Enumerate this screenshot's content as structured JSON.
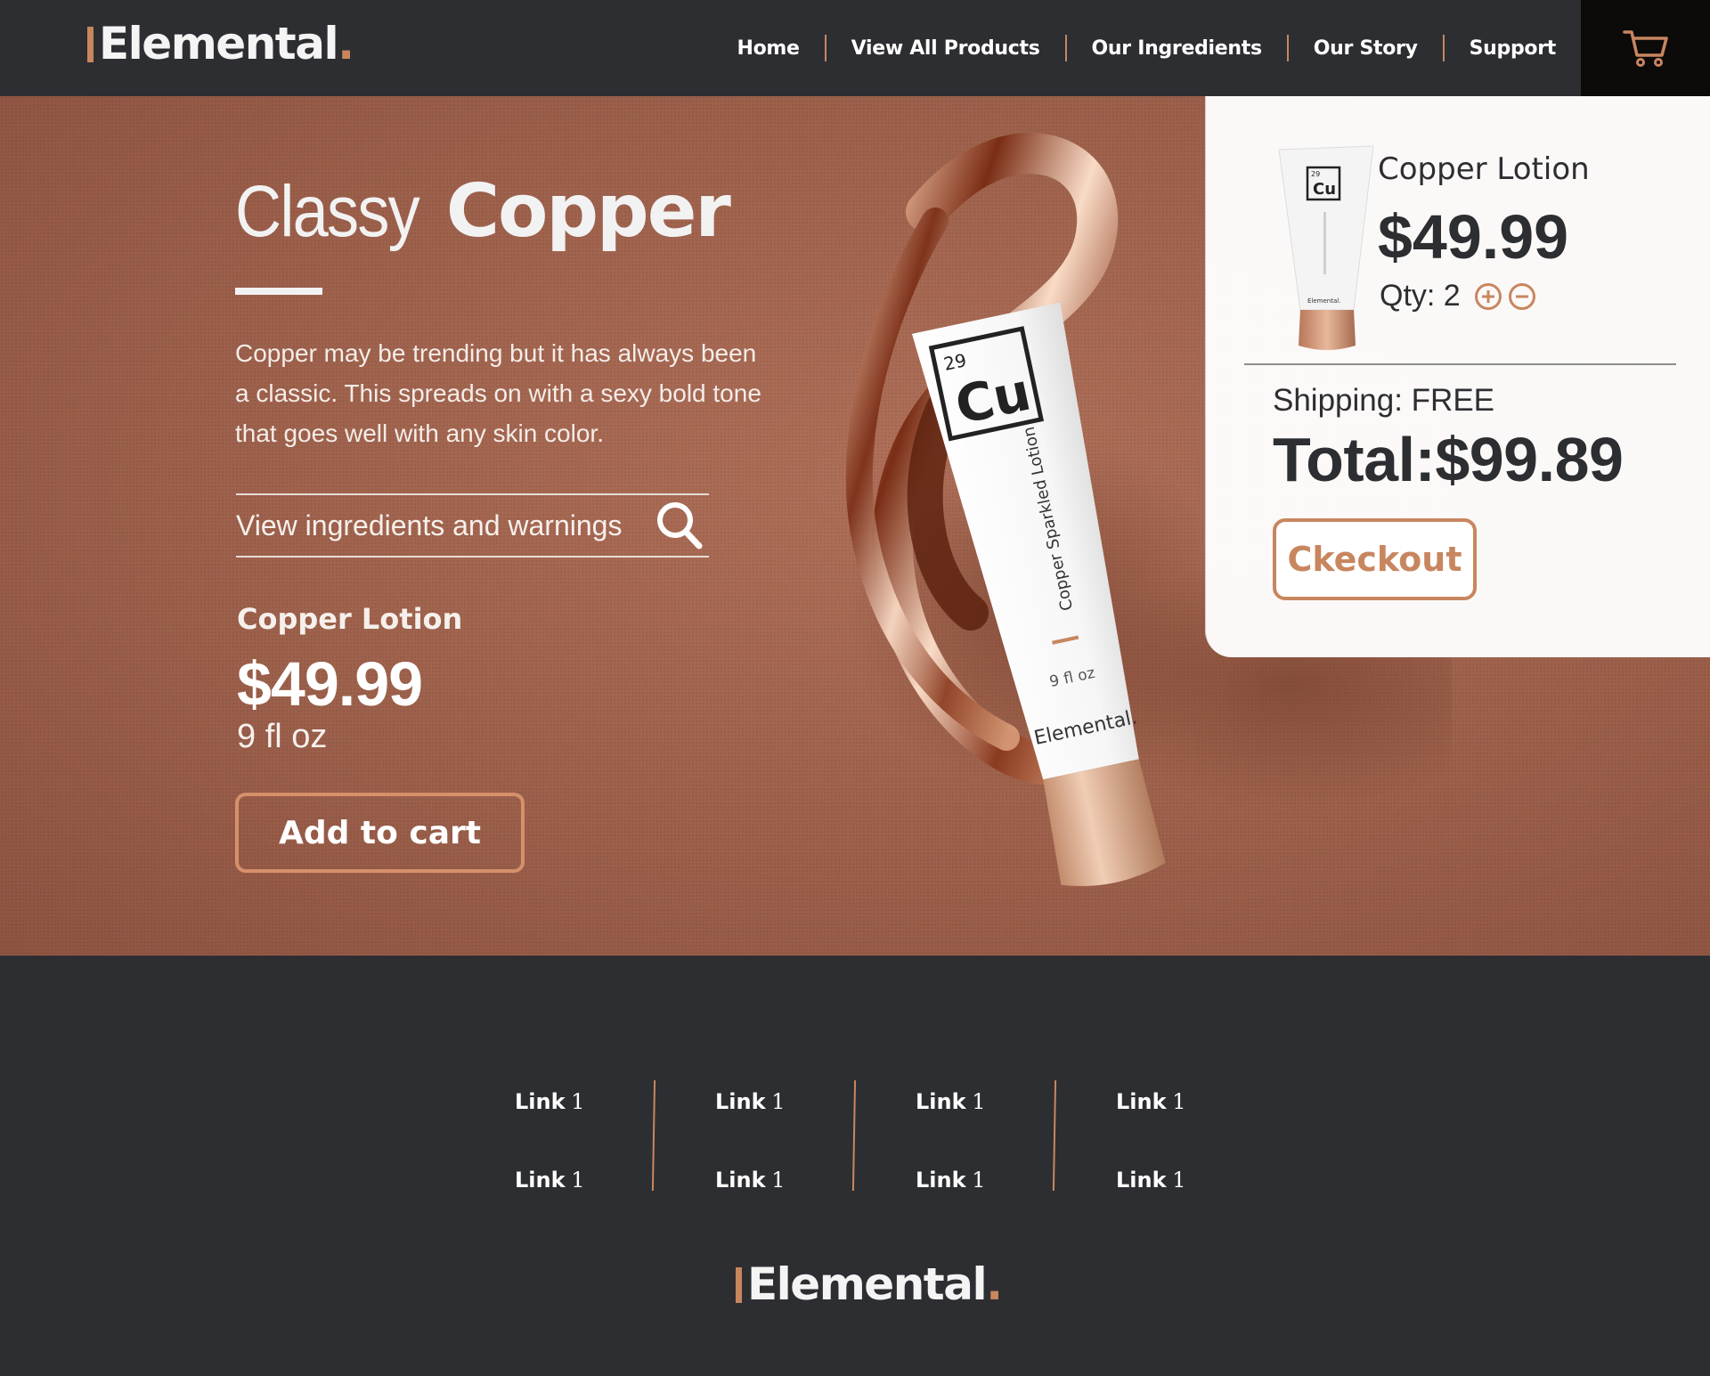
{
  "brand": {
    "name": "Elemental",
    "dot": ".",
    "accent_color": "#c8865f",
    "dark_color": "#2d2e31"
  },
  "nav": {
    "items": [
      {
        "label": "Home"
      },
      {
        "label": "View All Products"
      },
      {
        "label": "Our Ingredients"
      },
      {
        "label": "Our Story"
      },
      {
        "label": "Support"
      }
    ],
    "cart_icon": "cart-icon"
  },
  "hero": {
    "title_light": "Classy",
    "title_bold": "Copper",
    "description": "Copper may be trending but it has always been a classic. This spreads on with a sexy bold tone that goes well with any skin color.",
    "ingredients_link": "View ingredients and warnings",
    "ingredients_icon": "search-icon",
    "product_name": "Copper Lotion",
    "price": "$49.99",
    "size": "9 fl oz",
    "add_to_cart": "Add to cart",
    "tube": {
      "atomic_number": "29",
      "symbol": "Cu",
      "product_text": "Copper Sparkled Lotion",
      "volume": "9 fl oz",
      "brand": "Elemental."
    }
  },
  "cart": {
    "item_name": "Copper Lotion",
    "item_price": "$49.99",
    "qty_label": "Qty: 2",
    "plus_icon": "plus-circle-icon",
    "minus_icon": "minus-circle-icon",
    "shipping": "Shipping: FREE",
    "total": "Total:$99.89",
    "checkout": "Ckeckout"
  },
  "footer": {
    "links": [
      {
        "word": "Link",
        "num": "1"
      },
      {
        "word": "Link",
        "num": "1"
      },
      {
        "word": "Link",
        "num": "1"
      },
      {
        "word": "Link",
        "num": "1"
      },
      {
        "word": "Link",
        "num": "1"
      },
      {
        "word": "Link",
        "num": "1"
      },
      {
        "word": "Link",
        "num": "1"
      },
      {
        "word": "Link",
        "num": "1"
      }
    ]
  }
}
